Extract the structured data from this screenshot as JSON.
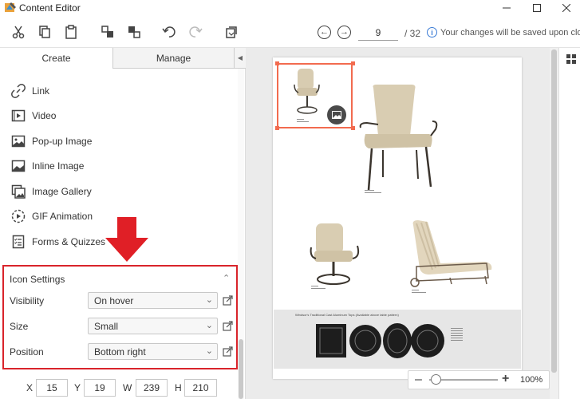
{
  "window": {
    "title": "Content Editor"
  },
  "toolbar": {
    "current_page": "9",
    "total_pages": "/ 32",
    "save_note": "Your changes will be saved upon close"
  },
  "tabs": {
    "create": "Create",
    "manage": "Manage"
  },
  "menu": {
    "items": [
      {
        "label": "Link",
        "icon": "link-icon"
      },
      {
        "label": "Video",
        "icon": "video-icon"
      },
      {
        "label": "Pop-up Image",
        "icon": "image-icon"
      },
      {
        "label": "Inline Image",
        "icon": "inline-image-icon"
      },
      {
        "label": "Image Gallery",
        "icon": "gallery-icon"
      },
      {
        "label": "GIF Animation",
        "icon": "gif-icon"
      },
      {
        "label": "Forms & Quizzes",
        "icon": "form-icon"
      }
    ]
  },
  "icon_settings": {
    "title": "Icon Settings",
    "visibility_label": "Visibility",
    "visibility_value": "On hover",
    "size_label": "Size",
    "size_value": "Small",
    "position_label": "Position",
    "position_value": "Bottom right"
  },
  "coords": {
    "x_label": "X",
    "x_value": "15",
    "y_label": "Y",
    "y_value": "19",
    "w_label": "W",
    "w_value": "239",
    "h_label": "H",
    "h_value": "210"
  },
  "zoom": {
    "value": "100%"
  },
  "page_content": {
    "band_title": "Windsor's Traditional Cast Aluminum Tops (Available above table pattern)"
  },
  "colors": {
    "highlight": "#d9242b",
    "selection": "#f26b4f",
    "accent": "#3a7bd5"
  }
}
